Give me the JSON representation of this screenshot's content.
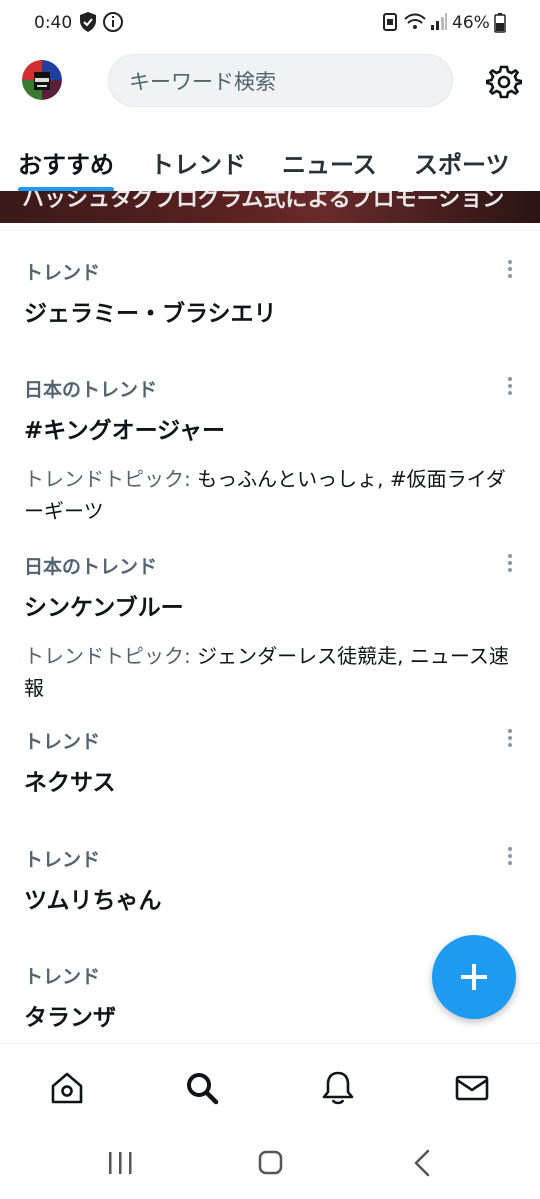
{
  "status_bar": {
    "time": "0:40",
    "battery": "46%",
    "icons": [
      "shield-check-icon",
      "info-icon",
      "notification-icon",
      "wifi-icon",
      "signal-icon",
      "battery-icon"
    ]
  },
  "header": {
    "search_placeholder": "キーワード検索",
    "settings_icon": "gear-icon"
  },
  "tabs": [
    {
      "label": "おすすめ",
      "active": true
    },
    {
      "label": "トレンド",
      "active": false
    },
    {
      "label": "ニュース",
      "active": false
    },
    {
      "label": "スポーツ",
      "active": false
    }
  ],
  "promo": {
    "text": "ハッシュタグプログラム式によるプロモーション"
  },
  "trends": [
    {
      "category": "トレンド",
      "name": "ジェラミー・ブラシエリ"
    },
    {
      "category": "日本のトレンド",
      "name": "#キングオージャー",
      "topic_label": "トレンドトピック:",
      "topic": " もっふんといっしょ, #仮面ライダーギーツ"
    },
    {
      "category": "日本のトレンド",
      "name": "シンケンブルー",
      "topic_label": "トレンドトピック:",
      "topic": " ジェンダーレス徒競走, ニュース速報"
    },
    {
      "category": "トレンド",
      "name": "ネクサス"
    },
    {
      "category": "トレンド",
      "name": "ツムリちゃん"
    },
    {
      "category": "トレンド",
      "name": "タランザ"
    }
  ],
  "fab": {
    "icon": "plus-icon"
  },
  "bottom_nav": [
    {
      "icon": "home-icon"
    },
    {
      "icon": "search-icon"
    },
    {
      "icon": "bell-icon"
    },
    {
      "icon": "mail-icon"
    }
  ],
  "system_nav": [
    "recents-icon",
    "home-button-icon",
    "back-icon"
  ],
  "colors": {
    "accent": "#1d9bf0",
    "secondary_text": "#536471",
    "primary_text": "#0f1419"
  }
}
